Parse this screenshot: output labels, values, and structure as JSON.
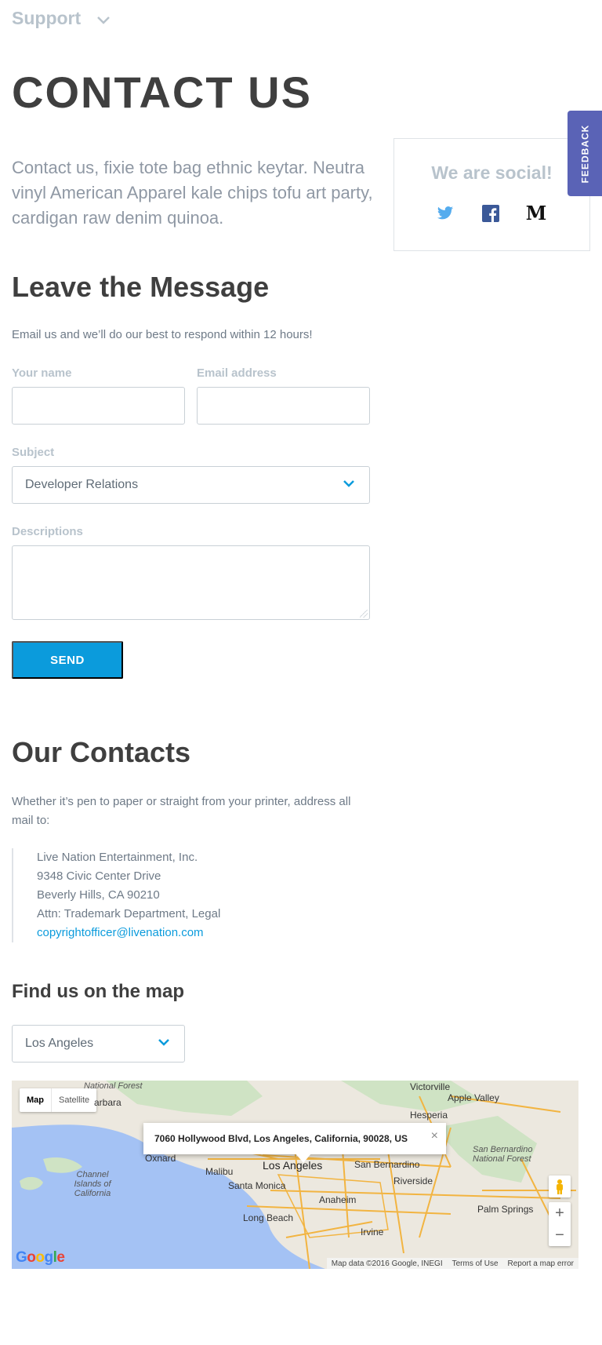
{
  "nav": {
    "support_label": "Support"
  },
  "page": {
    "title": "CONTACT US",
    "intro": "Contact us, fixie tote bag ethnic keytar. Neutra vinyl American Apparel kale chips tofu art party, cardigan raw denim quinoa."
  },
  "social": {
    "title": "We are social!",
    "icons": [
      "twitter-icon",
      "facebook-icon",
      "medium-icon"
    ],
    "medium_glyph": "M",
    "colors": {
      "twitter": "#55acee",
      "facebook": "#3b5998",
      "medium": "#111111"
    }
  },
  "feedback": {
    "label": "FEEDBACK",
    "color": "#5a63b6"
  },
  "message_form": {
    "title": "Leave the Message",
    "subtitle": "Email us and we’ll do our best to respond within 12 hours!",
    "name_label": "Your name",
    "name_value": "",
    "email_label": "Email address",
    "email_value": "",
    "subject_label": "Subject",
    "subject_value": "Developer Relations",
    "description_label": "Descriptions",
    "description_value": "",
    "send_label": "SEND",
    "accent_color": "#0b9bdc"
  },
  "contacts": {
    "title": "Our Contacts",
    "subtitle": "Whether it’s pen to paper or straight from your printer, address all mail to:",
    "address_lines": [
      "Live Nation Entertainment, Inc.",
      "9348 Civic Center Drive",
      "Beverly Hills, CA 90210",
      "Attn: Trademark Department, Legal"
    ],
    "email": "copyrightofficer@livenation.com"
  },
  "map_section": {
    "title": "Find us on the map",
    "city_value": "Los Angeles",
    "tab_map": "Map",
    "tab_satellite": "Satellite",
    "info_address": "7060 Hollywood Blvd, Los Angeles, California, 90028, US",
    "info_close": "×",
    "zoom_in": "+",
    "zoom_out": "−",
    "footer_data": "Map data ©2016 Google, INEGI",
    "footer_terms": "Terms of Use",
    "footer_report": "Report a map error",
    "logo": "Google",
    "places": {
      "forest": "National Forest",
      "barbara": "arbara",
      "victorville": "Victorville",
      "apple_valley": "Apple Valley",
      "hesperia": "Hesperia",
      "san_bernardino_nf": "San Bernardino National Forest",
      "oxnard": "Oxnard",
      "los_angeles": "Los Angeles",
      "san_bernardino": "San Bernardino",
      "malibu": "Malibu",
      "channel_islands": "Channel Islands of California",
      "santa_monica": "Santa Monica",
      "riverside": "Riverside",
      "anaheim": "Anaheim",
      "long_beach": "Long Beach",
      "palm_springs": "Palm Springs",
      "irvine": "Irvine"
    }
  }
}
